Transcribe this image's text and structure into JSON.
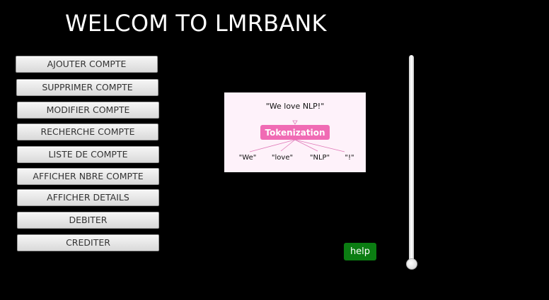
{
  "header": {
    "title": "WELCOM TO LMRBANK"
  },
  "menu": {
    "items": [
      {
        "label": "AJOUTER COMPTE"
      },
      {
        "label": "SUPPRIMER COMPTE"
      },
      {
        "label": "MODIFIER COMPTE"
      },
      {
        "label": "RECHERCHE COMPTE"
      },
      {
        "label": "LISTE DE COMPTE"
      },
      {
        "label": "AFFICHER NBRE COMPTE"
      },
      {
        "label": "AFFICHER DETAILS"
      },
      {
        "label": "DEBITER"
      },
      {
        "label": "CREDITER"
      }
    ]
  },
  "image": {
    "sentence": "\"We love NLP!\"",
    "center_label": "Tokenization",
    "tokens": [
      "\"We\"",
      "\"love\"",
      "\"NLP\"",
      "\"!\""
    ],
    "label_color": "#f06bb4"
  },
  "help": {
    "label": "help",
    "color": "#0b7d12"
  },
  "slider": {
    "value_fraction": 1.0
  }
}
